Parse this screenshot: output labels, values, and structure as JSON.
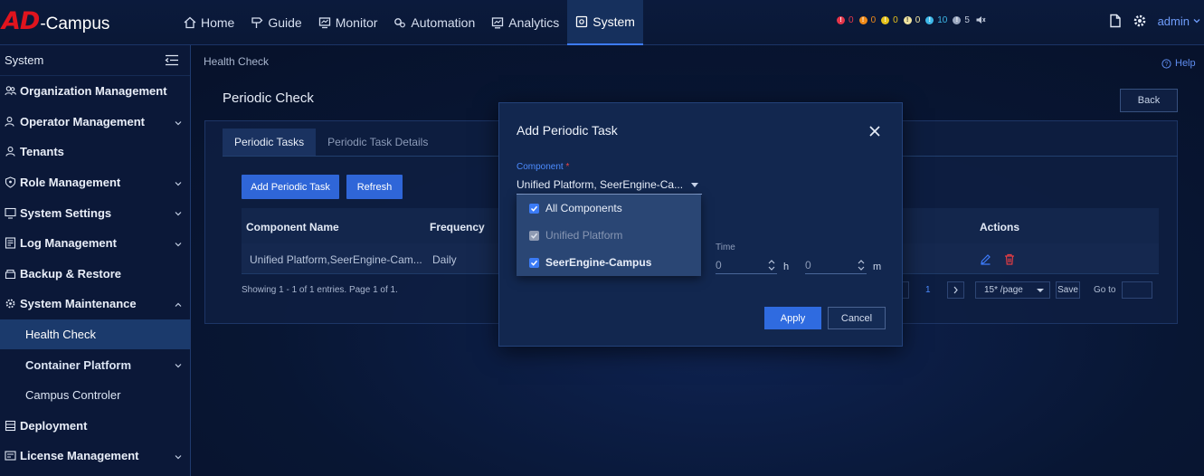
{
  "app": {
    "logo_ad": "AD",
    "logo_suffix": "-Campus"
  },
  "nav": [
    {
      "label": "Home",
      "icon": "home-icon"
    },
    {
      "label": "Guide",
      "icon": "signpost-icon"
    },
    {
      "label": "Monitor",
      "icon": "monitor-icon"
    },
    {
      "label": "Automation",
      "icon": "gears-icon"
    },
    {
      "label": "Analytics",
      "icon": "chart-icon"
    },
    {
      "label": "System",
      "icon": "settings-box-icon",
      "active": true
    }
  ],
  "alarms": [
    {
      "count": "0",
      "color": "#e5364a",
      "glyph": "!"
    },
    {
      "count": "0",
      "color": "#f08a18",
      "glyph": "!"
    },
    {
      "count": "0",
      "color": "#e6c21b",
      "glyph": "!"
    },
    {
      "count": "0",
      "color": "#f0e4a0",
      "glyph": "!"
    },
    {
      "count": "10",
      "color": "#3db8e8",
      "glyph": "!"
    },
    {
      "count": "5",
      "color": "#9aa7bf",
      "glyph": "!"
    }
  ],
  "user": {
    "name": "admin"
  },
  "sidebar": {
    "title": "System",
    "items": [
      {
        "label": "Organization Management",
        "type": "item"
      },
      {
        "label": "Operator Management",
        "type": "item",
        "expandable": true
      },
      {
        "label": "Tenants",
        "type": "item"
      },
      {
        "label": "Role Management",
        "type": "item",
        "expandable": true
      },
      {
        "label": "System Settings",
        "type": "item",
        "expandable": true
      },
      {
        "label": "Log Management",
        "type": "item",
        "expandable": true
      },
      {
        "label": "Backup & Restore",
        "type": "item"
      },
      {
        "label": "System Maintenance",
        "type": "item",
        "expanded": true
      },
      {
        "label": "Health Check",
        "type": "sub",
        "active": true
      },
      {
        "label": "Container Platform",
        "type": "sub",
        "bold": true,
        "expandable": true
      },
      {
        "label": "Campus Controler",
        "type": "sub"
      },
      {
        "label": "Deployment",
        "type": "item"
      },
      {
        "label": "License Management",
        "type": "item",
        "expandable": true
      }
    ]
  },
  "breadcrumb": "Health Check",
  "help_label": "Help",
  "page_title": "Periodic Check",
  "back_label": "Back",
  "tabs": [
    "Periodic Tasks",
    "Periodic Task Details"
  ],
  "toolbar": {
    "add_label": "Add Periodic Task",
    "refresh_label": "Refresh"
  },
  "table": {
    "columns": [
      "Component Name",
      "Frequency",
      "Actions"
    ],
    "rows": [
      {
        "component": "Unified Platform,SeerEngine-Cam...",
        "frequency": "Daily"
      }
    ]
  },
  "pager": {
    "info": "Showing 1 - 1 of 1 entries. Page 1 of 1.",
    "page": "1",
    "per_page": "15* /page",
    "save_label": "Save",
    "goto_label": "Go to"
  },
  "modal": {
    "title": "Add Periodic Task",
    "component_label": "Component",
    "required_mark": "*",
    "component_value": "Unified Platform, SeerEngine-Ca...",
    "options": [
      {
        "label": "All Components",
        "checked": true
      },
      {
        "label": "Unified Platform",
        "checked": true,
        "disabled": true
      },
      {
        "label": "SeerEngine-Campus",
        "checked": true
      }
    ],
    "time_label": "Time",
    "hours_value": "0",
    "hours_unit": "h",
    "minutes_value": "0",
    "minutes_unit": "m",
    "apply_label": "Apply",
    "cancel_label": "Cancel"
  }
}
